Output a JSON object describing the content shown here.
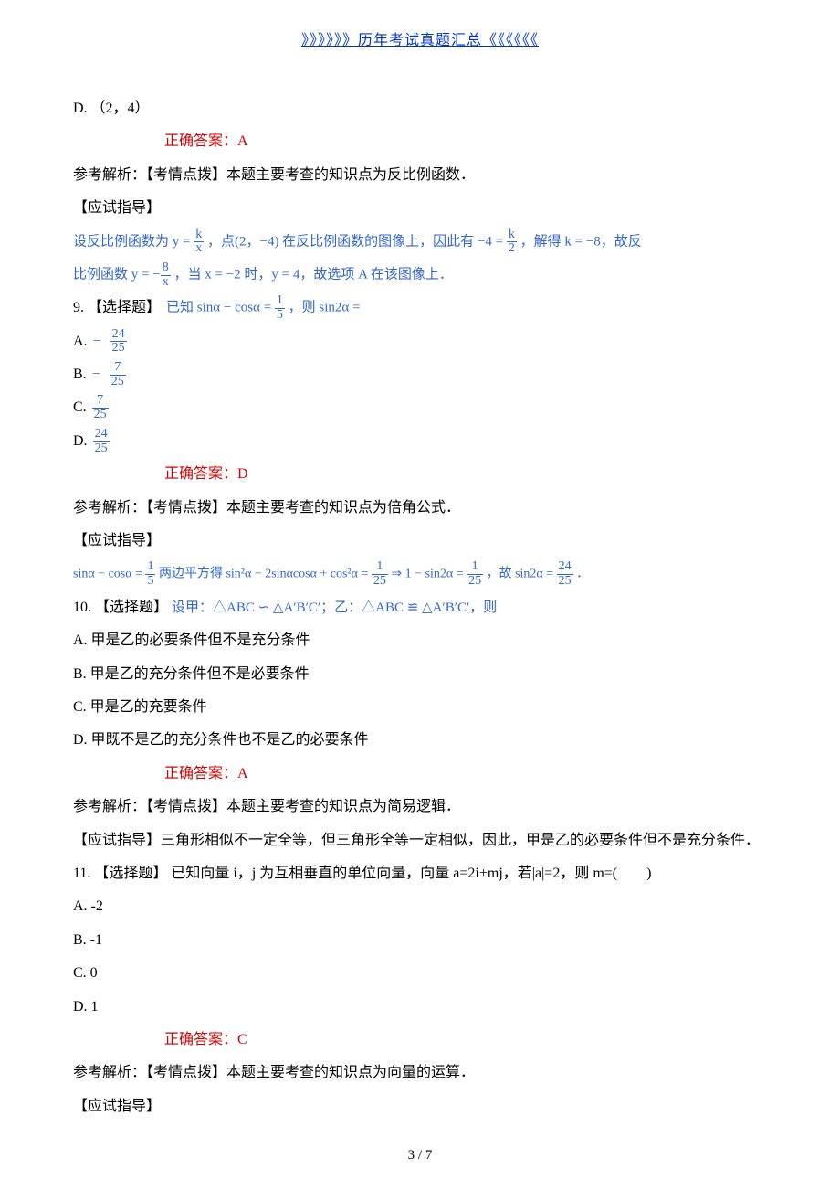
{
  "header": {
    "link_text": "》》》》》》历年考试真题汇总《《《《《《"
  },
  "q8": {
    "optD": "D. （2，4）",
    "answer_label": "正确答案：A",
    "analysis_label": "参考解析：【考情点拨】本题主要考查的知识点为反比例函数．",
    "guide_label": "【应试指导】",
    "guide_text1_pre": "设反比例函数为 ",
    "guide_text1_mid": "，点(2，−4) 在反比例函数的图像上，因此有 ",
    "guide_text1_post": "，解得 k = −8，故反",
    "guide_text2_pre": "比例函数 ",
    "guide_text2_mid": "，当 x = −2 时，y = 4，故选项 A 在该图像上．"
  },
  "q9": {
    "stem_pre": "9. 【选择题】 ",
    "stem_math_pre": "已知 sinα − cosα = ",
    "stem_math_post": "，则 sin2α =",
    "optA_label": "A.",
    "optA_num": "24",
    "optA_den": "25",
    "optB_label": "B.",
    "optB_num": "7",
    "optB_den": "25",
    "optC_label": "C.",
    "optC_num": "7",
    "optC_den": "25",
    "optD_label": "D.",
    "optD_num": "24",
    "optD_den": "25",
    "answer_label": "正确答案：D",
    "analysis_label": "参考解析：【考情点拨】本题主要考查的知识点为倍角公式．",
    "guide_label": "【应试指导】",
    "guide_math_1": "sinα − cosα = ",
    "guide_math_2": " 两边平方得 sin²α − 2sinαcosα + cos²α = ",
    "guide_math_3": " ⇒ 1 − sin2α = ",
    "guide_math_4": "，故 sin2α = ",
    "guide_math_5": "．"
  },
  "q10": {
    "stem_pre": "10. 【选择题】 ",
    "stem_math": "设甲：△ABC ∽ △A′B′C′；乙：△ABC ≌ △A′B′C′，则",
    "optA": "A. 甲是乙的必要条件但不是充分条件",
    "optB": "B. 甲是乙的充分条件但不是必要条件",
    "optC": "C. 甲是乙的充要条件",
    "optD": "D. 甲既不是乙的充分条件也不是乙的必要条件",
    "answer_label": "正确答案：A",
    "analysis_label": "参考解析：【考情点拨】本题主要考查的知识点为简易逻辑．",
    "guide_text": "【应试指导】三角形相似不一定全等，但三角形全等一定相似，因此，甲是乙的必要条件但不是充分条件．"
  },
  "q11": {
    "stem": "11. 【选择题】 已知向量 i，j 为互相垂直的单位向量，向量 a=2i+mj，若|a|=2，则 m=(　　)",
    "optA": "A. -2",
    "optB": "B. -1",
    "optC": "C. 0",
    "optD": "D. 1",
    "answer_label": "正确答案：C",
    "analysis_label": "参考解析：【考情点拨】本题主要考查的知识点为向量的运算．",
    "guide_label": "【应试指导】"
  },
  "footer": {
    "page": "3 / 7"
  }
}
